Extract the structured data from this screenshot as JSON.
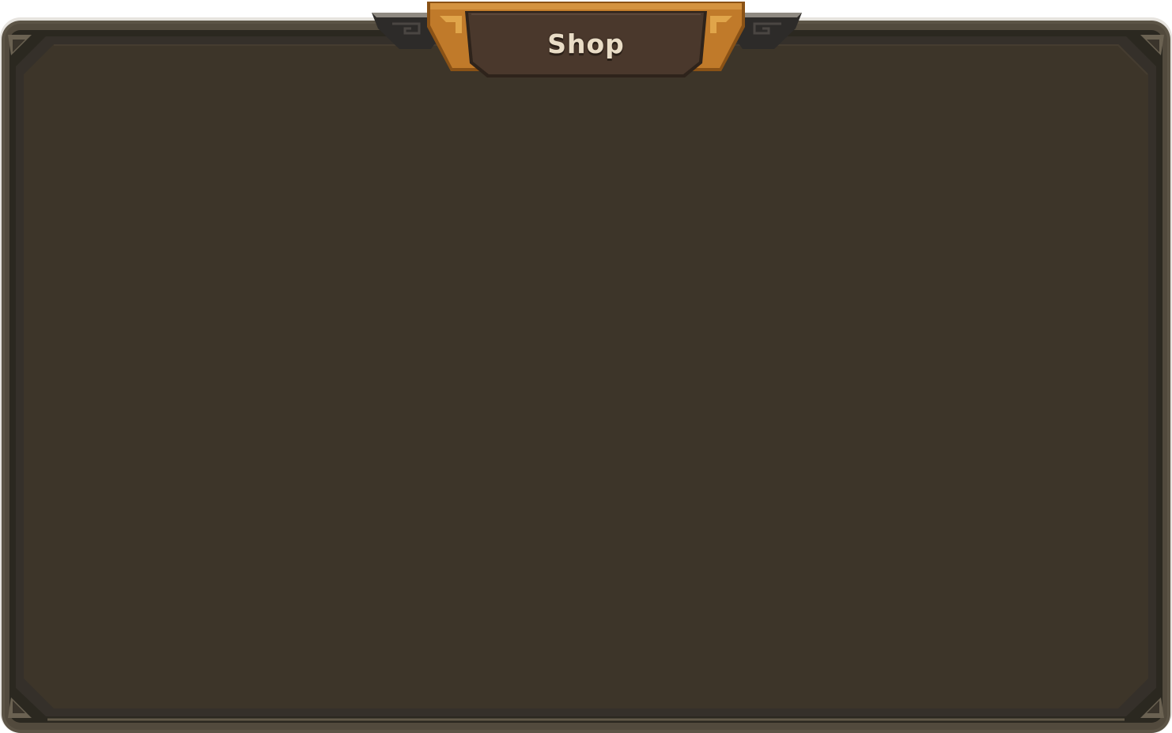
{
  "window": {
    "title": "Shop"
  },
  "colors": {
    "outer_rim": "#5c5446",
    "frame_dark": "#2b2820",
    "panel_fill": "#3d3529",
    "panel_edge": "#35302a",
    "banner_orange": "#c07a2a",
    "banner_orange_dark": "#8a5216",
    "banner_plate": "#4a382c",
    "banner_wing": "#2d2b29",
    "title_text": "#e9dcc6"
  },
  "icons": {
    "top_left_corner": "corner-ornament-icon",
    "top_right_corner": "corner-ornament-icon",
    "bottom_left_corner": "corner-ornament-icon",
    "bottom_right_corner": "corner-ornament-icon",
    "banner_left_scroll": "scroll-ornament-icon",
    "banner_right_scroll": "scroll-ornament-icon"
  }
}
